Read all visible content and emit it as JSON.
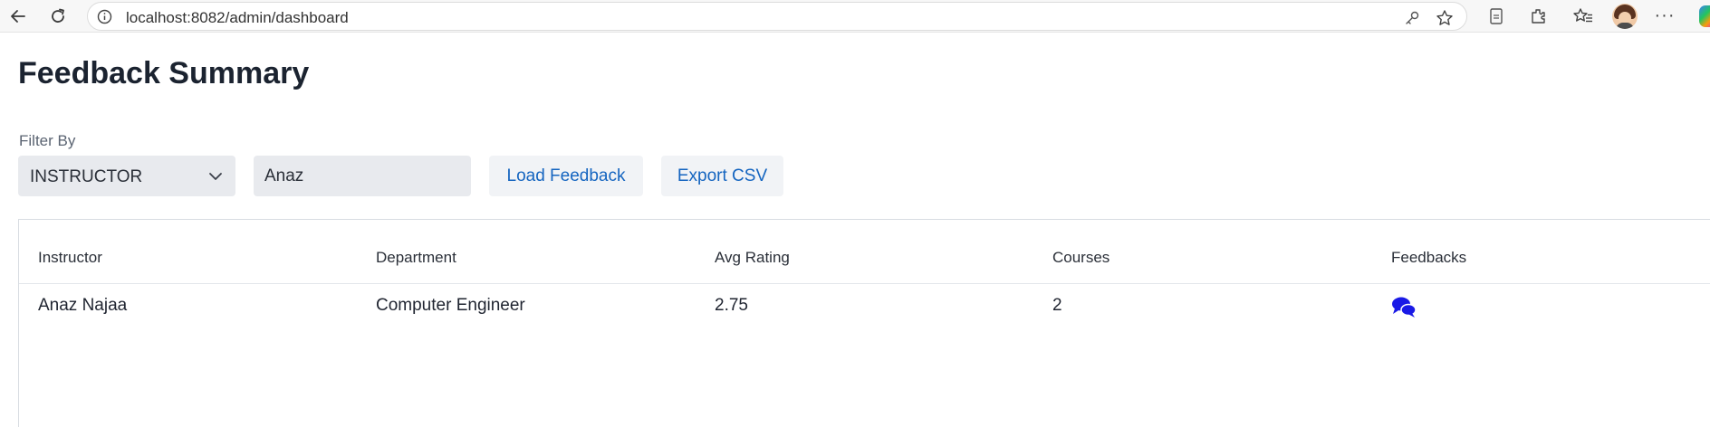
{
  "browser": {
    "url": "localhost:8082/admin/dashboard"
  },
  "page": {
    "title": "Feedback Summary",
    "filter_label": "Filter By",
    "filter_select_value": "INSTRUCTOR",
    "search_value": "Anaz",
    "load_button": "Load Feedback",
    "export_button": "Export CSV"
  },
  "table": {
    "columns": [
      "Instructor",
      "Department",
      "Avg Rating",
      "Courses",
      "Feedbacks"
    ],
    "rows": [
      {
        "instructor": "Anaz Najaa",
        "department": "Computer Engineer",
        "avg_rating": "2.75",
        "courses": "2",
        "feedbacks_icon": "comments-icon"
      }
    ]
  },
  "colors": {
    "accent": "#1565c0",
    "feedback_icon": "#1a1ae6"
  }
}
